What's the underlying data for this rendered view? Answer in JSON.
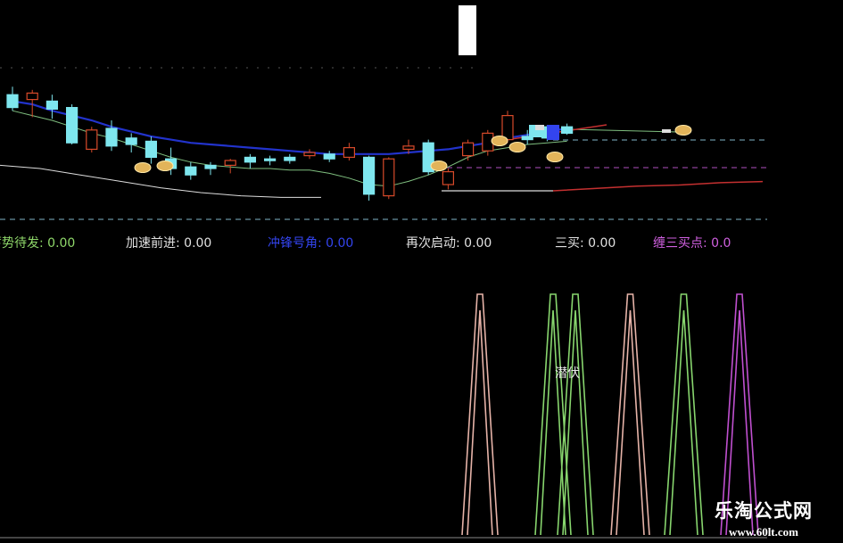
{
  "colors": {
    "background": "#000000",
    "ma_blue": "#2233cc",
    "ma_green": "#7fbf7f",
    "ma_red": "#c43030",
    "baseline_white": "#dddddd",
    "dashed_cyan": "#7fb3c8",
    "dashed_magenta": "#b050c0",
    "candle_up": "#d84a2a",
    "candle_down": "#7ee6ee",
    "peak_pink": "#e6b3a8",
    "peak_green": "#88d66e",
    "peak_magenta": "#c050d0"
  },
  "legend": [
    {
      "label": "蓄势待发",
      "value": "0.00",
      "color": "#8fd86a"
    },
    {
      "label": "加速前进",
      "value": "0.00",
      "color": "#e0e0e0"
    },
    {
      "label": "冲锋号角",
      "value": "0.00",
      "color": "#3344ee"
    },
    {
      "label": "再次启动",
      "value": "0.00",
      "color": "#e0e0e0"
    },
    {
      "label": "三买",
      "value": "0.00",
      "color": "#e0e0e0"
    },
    {
      "label": "缠三买点",
      "value": "0.0",
      "color": "#d060e0"
    }
  ],
  "indicator_label": "潜伏",
  "watermark": {
    "title": "乐淘公式网",
    "url": "www.60lt.com"
  },
  "chart_data": {
    "type": "candlestick",
    "candles": [
      {
        "o": 8.6,
        "h": 9.1,
        "l": 7.6,
        "c": 7.8
      },
      {
        "o": 8.3,
        "h": 8.9,
        "l": 7.2,
        "c": 8.7
      },
      {
        "o": 8.2,
        "h": 8.6,
        "l": 7.1,
        "c": 7.7
      },
      {
        "o": 7.8,
        "h": 8.0,
        "l": 5.5,
        "c": 5.6
      },
      {
        "o": 5.2,
        "h": 6.6,
        "l": 5.0,
        "c": 6.4
      },
      {
        "o": 6.5,
        "h": 7.0,
        "l": 5.1,
        "c": 5.4
      },
      {
        "o": 5.9,
        "h": 6.2,
        "l": 5.0,
        "c": 5.5
      },
      {
        "o": 5.7,
        "h": 6.0,
        "l": 4.3,
        "c": 4.7
      },
      {
        "o": 4.6,
        "h": 5.3,
        "l": 3.6,
        "c": 4.0
      },
      {
        "o": 4.1,
        "h": 4.4,
        "l": 3.3,
        "c": 3.6
      },
      {
        "o": 4.2,
        "h": 4.4,
        "l": 3.6,
        "c": 4.0
      },
      {
        "o": 4.2,
        "h": 4.6,
        "l": 3.7,
        "c": 4.5
      },
      {
        "o": 4.7,
        "h": 4.9,
        "l": 4.0,
        "c": 4.4
      },
      {
        "o": 4.6,
        "h": 4.8,
        "l": 4.2,
        "c": 4.5
      },
      {
        "o": 4.7,
        "h": 4.9,
        "l": 4.3,
        "c": 4.5
      },
      {
        "o": 4.8,
        "h": 5.2,
        "l": 4.6,
        "c": 5.0
      },
      {
        "o": 4.9,
        "h": 5.1,
        "l": 4.4,
        "c": 4.6
      },
      {
        "o": 4.7,
        "h": 5.6,
        "l": 4.5,
        "c": 5.3
      },
      {
        "o": 4.7,
        "h": 4.8,
        "l": 2.0,
        "c": 2.4
      },
      {
        "o": 2.3,
        "h": 4.7,
        "l": 2.1,
        "c": 4.6
      },
      {
        "o": 5.2,
        "h": 5.8,
        "l": 4.9,
        "c": 5.4
      },
      {
        "o": 5.6,
        "h": 5.8,
        "l": 3.6,
        "c": 3.8
      },
      {
        "o": 3.0,
        "h": 4.0,
        "l": 2.7,
        "c": 3.8
      },
      {
        "o": 4.8,
        "h": 5.8,
        "l": 4.5,
        "c": 5.6
      },
      {
        "o": 5.1,
        "h": 6.4,
        "l": 4.8,
        "c": 6.2
      },
      {
        "o": 5.8,
        "h": 7.6,
        "l": 5.6,
        "c": 7.3
      },
      {
        "o": 6.0,
        "h": 6.4,
        "l": 5.5,
        "c": 5.8
      },
      {
        "o": 6.6,
        "h": 6.7,
        "l": 5.7,
        "c": 5.9
      },
      {
        "o": 6.6,
        "h": 6.8,
        "l": 6.1,
        "c": 6.2
      }
    ],
    "ma_blue": [
      8.2,
      8.0,
      7.6,
      7.3,
      7.0,
      6.6,
      6.3,
      6.0,
      5.8,
      5.6,
      5.5,
      5.4,
      5.3,
      5.2,
      5.1,
      5.0,
      4.9,
      4.9,
      4.9,
      4.9,
      5.0,
      5.1,
      5.2,
      5.4,
      5.6,
      5.9,
      6.1,
      6.3,
      6.5
    ],
    "ma_green": [
      7.6,
      7.3,
      7.0,
      6.6,
      6.2,
      5.9,
      5.5,
      5.1,
      4.7,
      4.4,
      4.2,
      4.1,
      4.0,
      4.0,
      3.9,
      3.9,
      3.7,
      3.4,
      3.0,
      2.9,
      3.2,
      3.6,
      4.1,
      4.7,
      5.1,
      5.3,
      5.5,
      5.6,
      5.7
    ],
    "ma_red": [
      2.0,
      2.2,
      2.4,
      2.5,
      2.7,
      2.8
    ],
    "baseline_white": [
      4.2,
      4.0,
      3.6,
      3.2,
      2.8,
      2.5,
      2.3,
      2.2,
      2.2
    ],
    "indicator_peaks": [
      {
        "color": "pink",
        "height": 1.0
      },
      {
        "color": "green",
        "height": 1.0
      },
      {
        "color": "green",
        "height": 1.0
      },
      {
        "color": "pink",
        "height": 1.0
      },
      {
        "color": "green",
        "height": 1.0
      },
      {
        "color": "magenta",
        "height": 1.0
      }
    ]
  }
}
